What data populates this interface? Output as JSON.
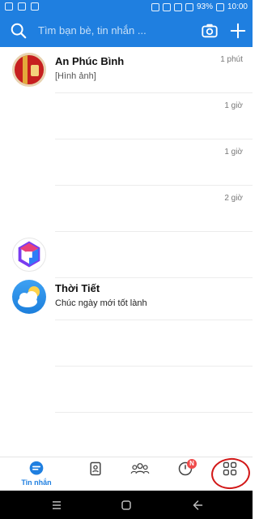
{
  "status_bar": {
    "battery_text": "93%",
    "time": "10:00"
  },
  "header": {
    "search_placeholder": "Tìm bạn bè, tin nhắn ..."
  },
  "conversations": [
    {
      "name": "An Phúc Bình",
      "preview": "[Hình ảnh]",
      "time": "1 phút"
    },
    {
      "name": "",
      "preview": "",
      "time": "1 giờ"
    },
    {
      "name": "",
      "preview": "",
      "time": "1 giờ"
    },
    {
      "name": "",
      "preview": "",
      "time": "2 giờ"
    },
    {
      "name": "",
      "preview": "",
      "time": ""
    },
    {
      "name": "Thời Tiết",
      "preview": "Chúc ngày mới tốt lành",
      "time": ""
    }
  ],
  "bottom_nav": {
    "messages_label": "Tin nhắn",
    "timeline_badge": "N"
  },
  "colors": {
    "brand": "#1f7fe0",
    "badge": "#ef4b4b",
    "annotation": "#d21818"
  }
}
